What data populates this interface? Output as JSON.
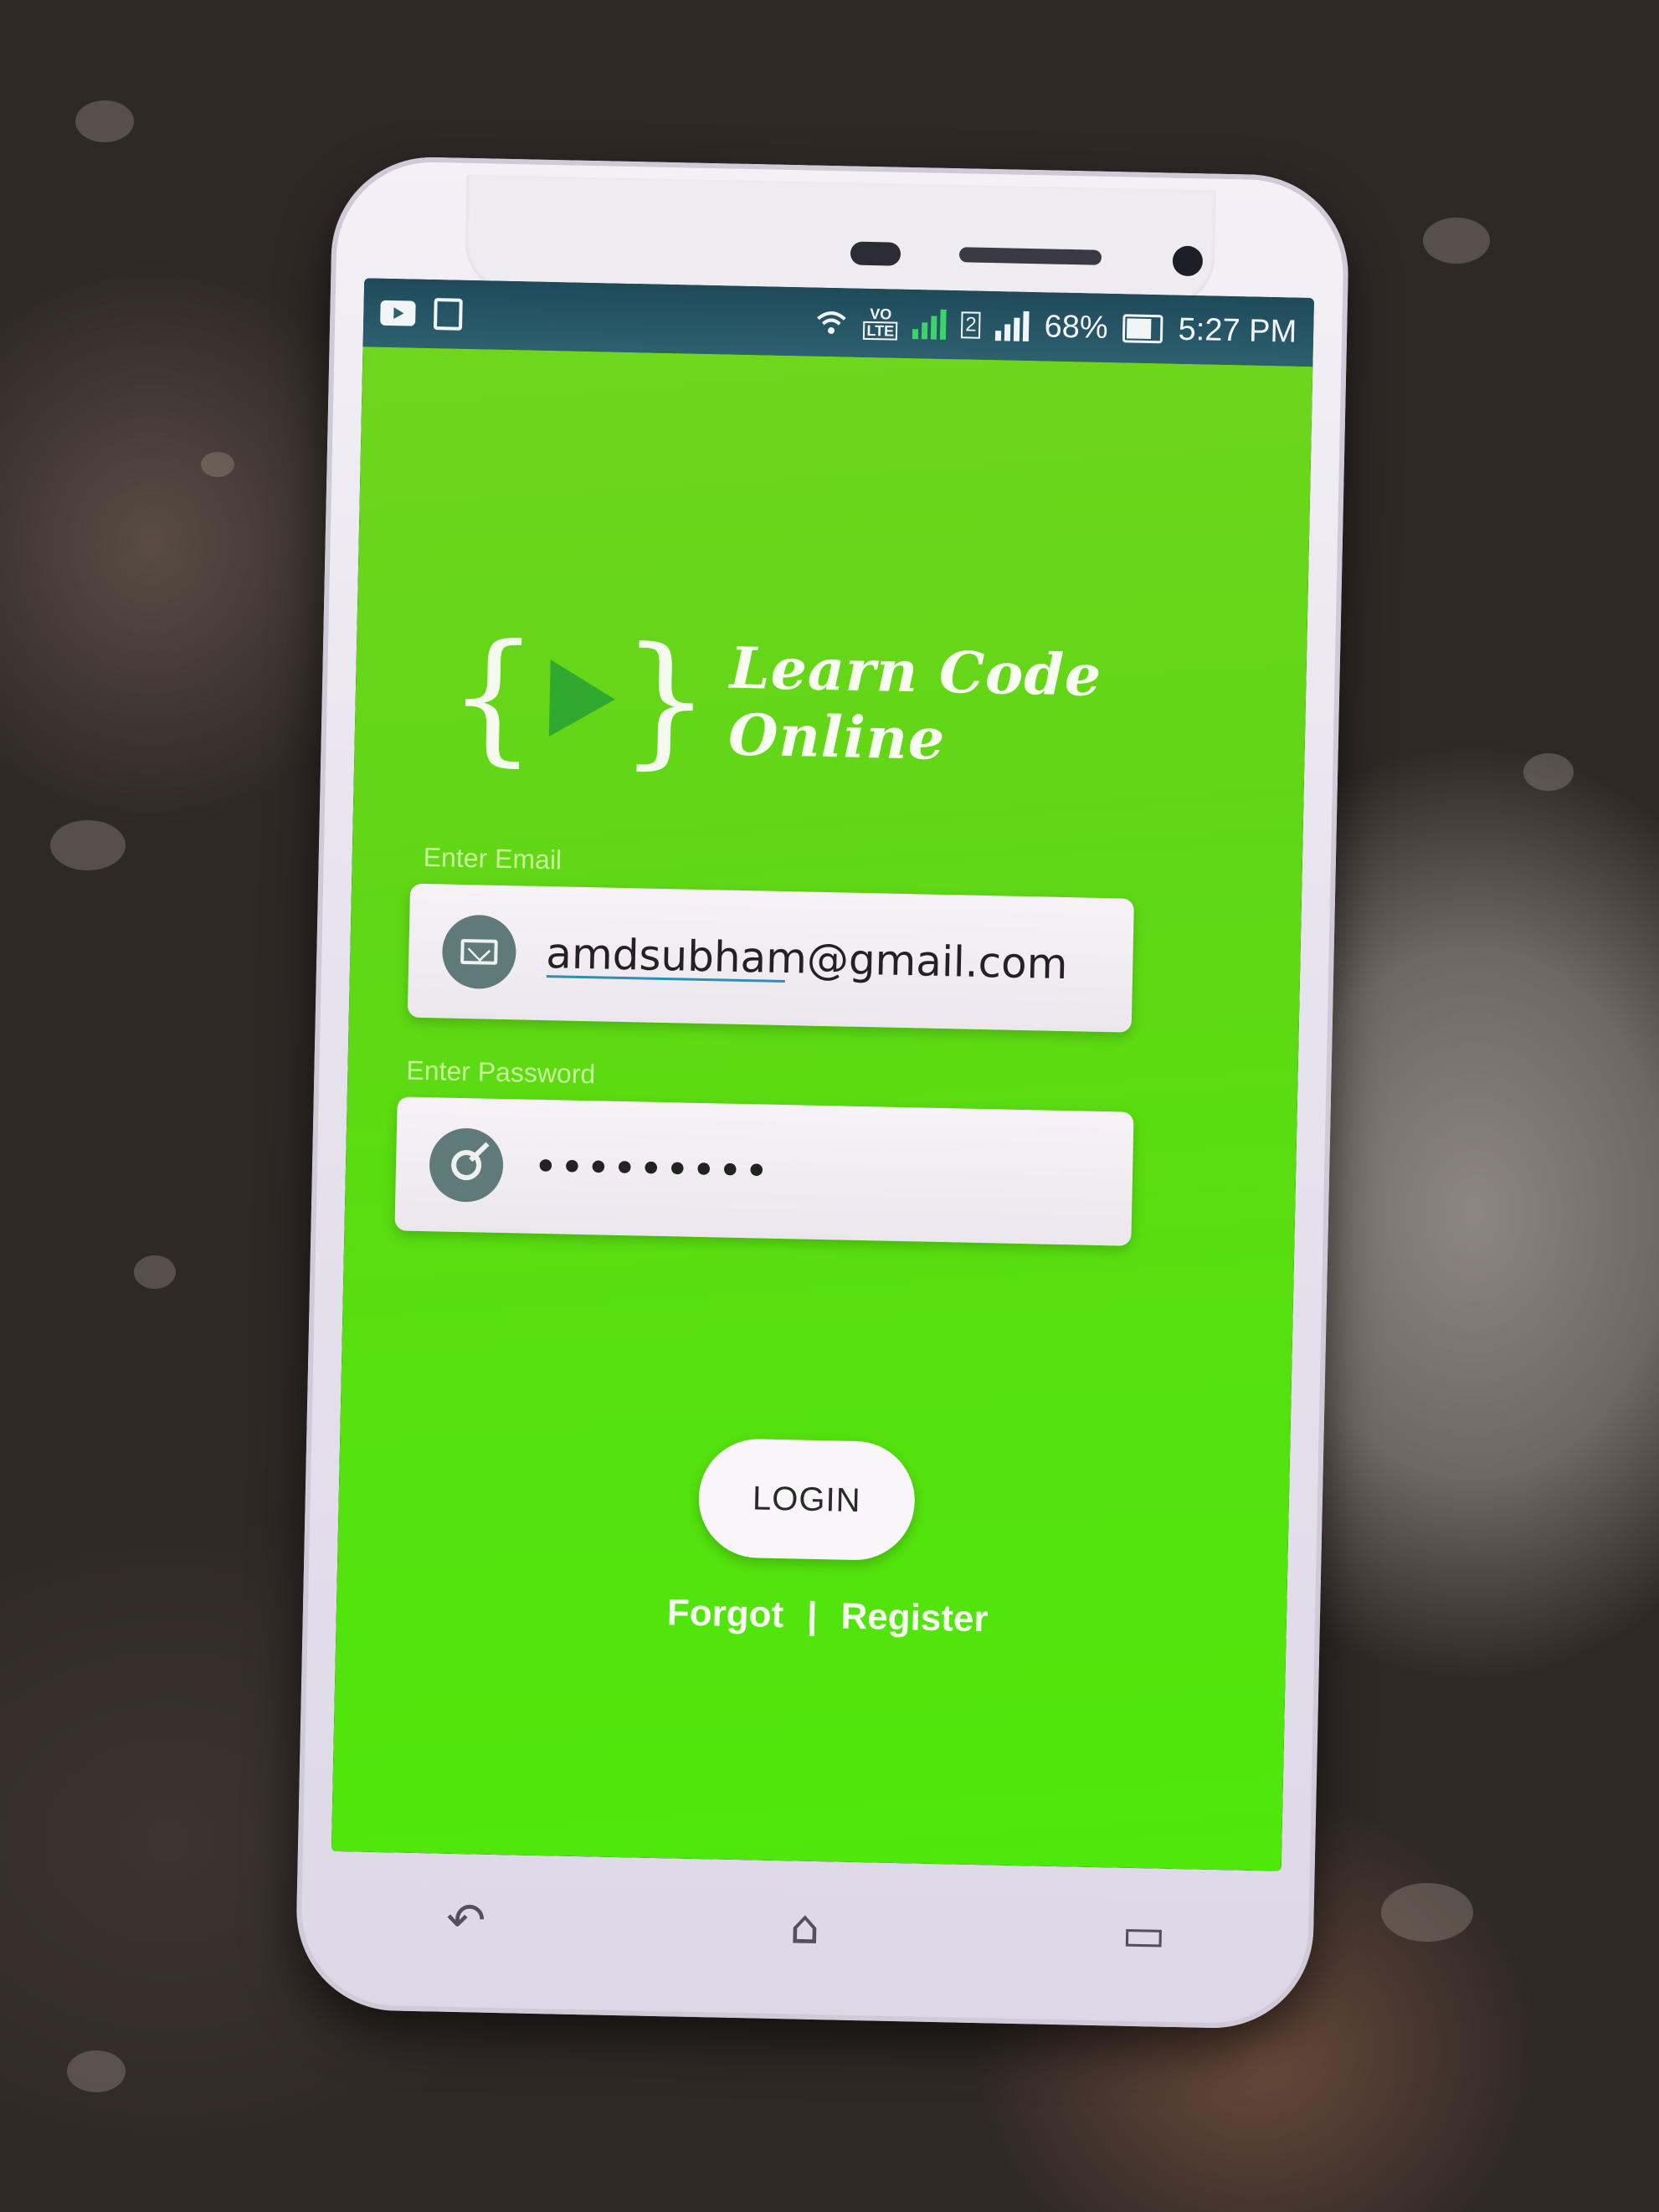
{
  "status_bar": {
    "battery": "68%",
    "time": "5:27 PM",
    "volte": "VO",
    "lte": "LTE",
    "sim2": "2",
    "battery_level": 0.68
  },
  "app": {
    "logo_text": "Learn Code Online",
    "email": {
      "label": "Enter Email",
      "value": "amdsubham@gmail.com"
    },
    "password": {
      "label": "Enter Password",
      "value": "•••••••••"
    },
    "login_label": "LOGIN",
    "forgot_label": "Forgot",
    "separator": "|",
    "register_label": "Register"
  },
  "nav": {
    "back": "↶",
    "home": "⌂",
    "recents": "▭"
  },
  "colors": {
    "app_green": "#62d617",
    "status_bar": "#2d6070",
    "phone_body": "#ebe7f0"
  }
}
